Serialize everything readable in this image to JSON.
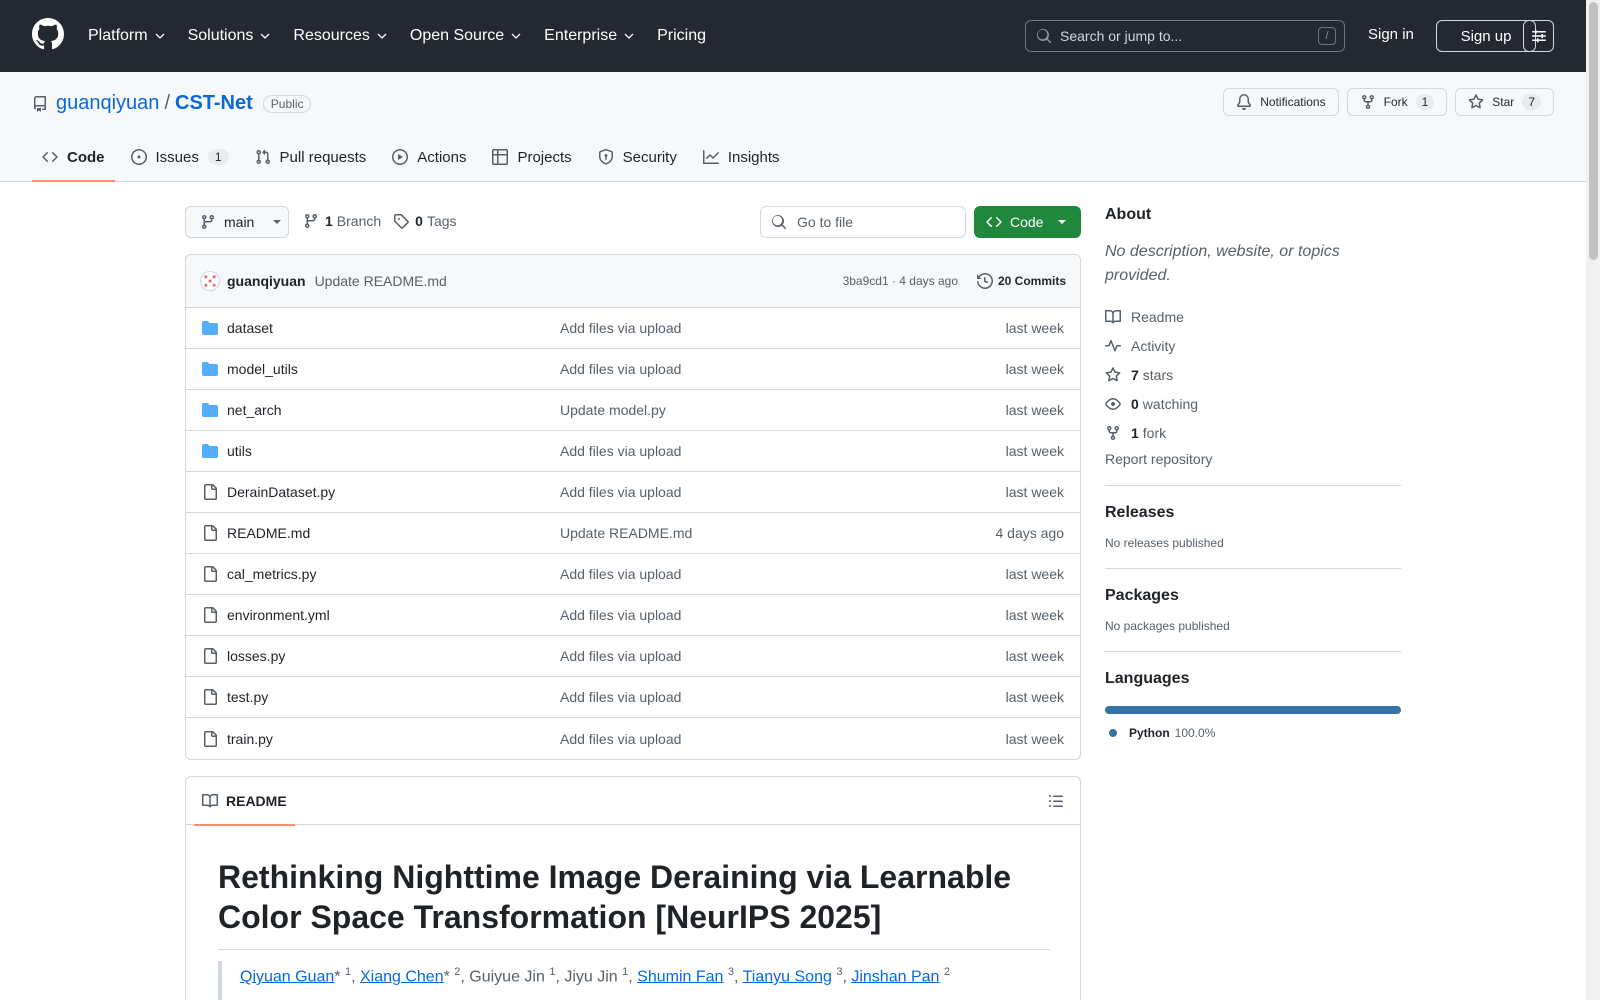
{
  "header": {
    "nav": [
      "Platform",
      "Solutions",
      "Resources",
      "Open Source",
      "Enterprise",
      "Pricing"
    ],
    "search_placeholder": "Search or jump to...",
    "search_shortcut": "/",
    "signin": "Sign in",
    "signup": "Sign up"
  },
  "repo": {
    "owner": "guanqiyuan",
    "separator": "/",
    "name": "CST-Net",
    "visibility": "Public",
    "notifications_label": "Notifications",
    "fork_label": "Fork",
    "fork_count": "1",
    "star_label": "Star",
    "star_count": "7"
  },
  "tabs": [
    {
      "label": "Code",
      "icon": "code-icon"
    },
    {
      "label": "Issues",
      "icon": "issue-icon",
      "count": "1"
    },
    {
      "label": "Pull requests",
      "icon": "pull-request-icon"
    },
    {
      "label": "Actions",
      "icon": "play-icon"
    },
    {
      "label": "Projects",
      "icon": "table-icon"
    },
    {
      "label": "Security",
      "icon": "shield-icon"
    },
    {
      "label": "Insights",
      "icon": "graph-icon"
    }
  ],
  "branchbar": {
    "branch": "main",
    "branch_count": "1",
    "branch_label": "Branch",
    "tag_count": "0",
    "tag_label": "Tags",
    "goto_placeholder": "Go to file",
    "code_button": "Code"
  },
  "commit": {
    "author": "guanqiyuan",
    "message": "Update README.md",
    "meta": "3ba9cd1 · 4 days ago",
    "commits": "20 Commits"
  },
  "files": [
    {
      "name": "dataset",
      "type": "dir",
      "message": "Add files via upload",
      "time": "last week"
    },
    {
      "name": "model_utils",
      "type": "dir",
      "message": "Add files via upload",
      "time": "last week"
    },
    {
      "name": "net_arch",
      "type": "dir",
      "message": "Update model.py",
      "time": "last week"
    },
    {
      "name": "utils",
      "type": "dir",
      "message": "Add files via upload",
      "time": "last week"
    },
    {
      "name": "DerainDataset.py",
      "type": "file",
      "message": "Add files via upload",
      "time": "last week"
    },
    {
      "name": "README.md",
      "type": "file",
      "message": "Update README.md",
      "time": "4 days ago"
    },
    {
      "name": "cal_metrics.py",
      "type": "file",
      "message": "Add files via upload",
      "time": "last week"
    },
    {
      "name": "environment.yml",
      "type": "file",
      "message": "Add files via upload",
      "time": "last week"
    },
    {
      "name": "losses.py",
      "type": "file",
      "message": "Add files via upload",
      "time": "last week"
    },
    {
      "name": "test.py",
      "type": "file",
      "message": "Add files via upload",
      "time": "last week"
    },
    {
      "name": "train.py",
      "type": "file",
      "message": "Add files via upload",
      "time": "last week"
    }
  ],
  "readme": {
    "tab": "README",
    "title": "Rethinking Nighttime Image Deraining via Learnable Color Space Transformation [NeurIPS 2025]",
    "authors": [
      {
        "name": "Qiyuan Guan",
        "link": true,
        "suffix": "* ",
        "sup": "1"
      },
      {
        "name": "Xiang Chen",
        "link": true,
        "suffix": "* ",
        "sup": "2"
      },
      {
        "name": "Guiyue Jin",
        "link": false,
        "suffix": " ",
        "sup": "1"
      },
      {
        "name": "Jiyu Jin",
        "link": false,
        "suffix": " ",
        "sup": "1"
      },
      {
        "name": "Shumin Fan",
        "link": true,
        "suffix": " ",
        "sup": "3"
      },
      {
        "name": "Tianyu Song",
        "link": true,
        "suffix": " ",
        "sup": "3"
      },
      {
        "name": "Jinshan Pan",
        "link": true,
        "suffix": " ",
        "sup": "2"
      }
    ]
  },
  "sidebar": {
    "about": "About",
    "description": "No description, website, or topics provided.",
    "readme": "Readme",
    "activity": "Activity",
    "stars_count": "7",
    "stars_label": "stars",
    "watching_count": "0",
    "watching_label": "watching",
    "fork_count": "1",
    "fork_label": "fork",
    "report": "Report repository",
    "releases": "Releases",
    "releases_empty": "No releases published",
    "packages": "Packages",
    "packages_empty": "No packages published",
    "languages": "Languages",
    "language_name": "Python",
    "language_pct": "100.0%",
    "language_color": "#3572a5"
  },
  "colors": {
    "header_bg": "#24292f",
    "link": "#0969da",
    "primary_button": "#1f883d",
    "active_tab_underline": "#fd8c73"
  }
}
